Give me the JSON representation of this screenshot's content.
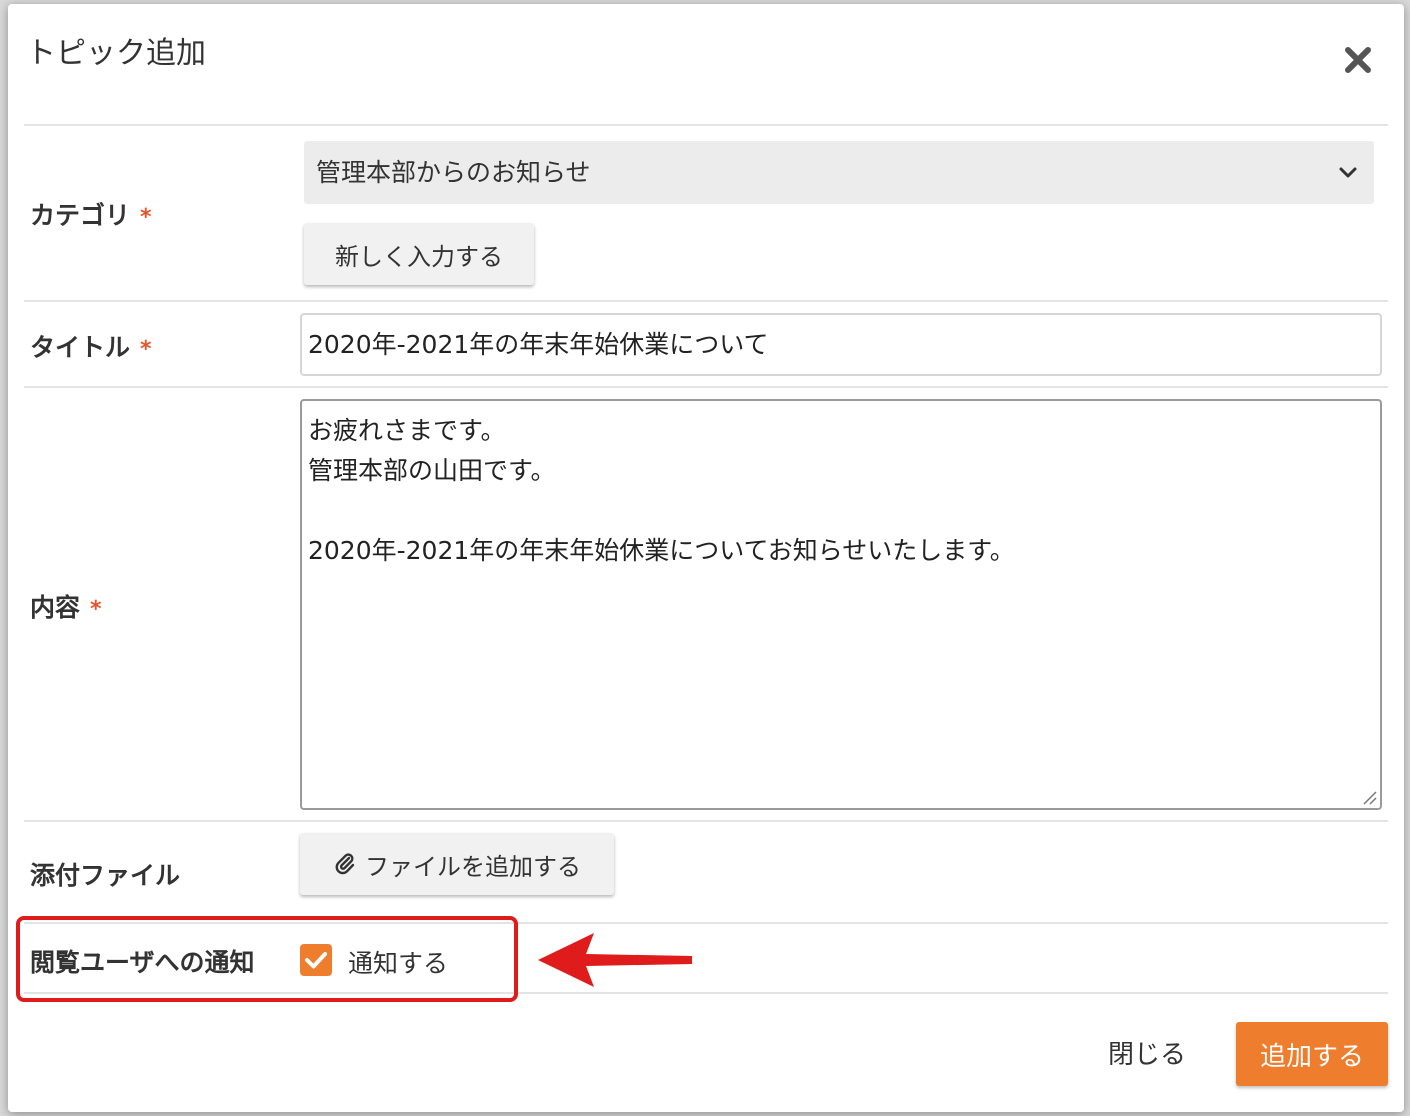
{
  "dialog": {
    "title": "トピック追加",
    "close_icon": "close-icon"
  },
  "fields": {
    "category": {
      "label": "カテゴリ",
      "required_mark": "*",
      "selected": "管理本部からのお知らせ",
      "new_button_label": "新しく入力する"
    },
    "title": {
      "label": "タイトル",
      "required_mark": "*",
      "value": "2020年-2021年の年末年始休業について"
    },
    "content": {
      "label": "内容",
      "required_mark": "*",
      "lines": [
        "お疲れさまです。",
        "管理本部の山田です。",
        "",
        "2020年-2021年の年末年始休業についてお知らせいたします。"
      ]
    },
    "attachment": {
      "label": "添付ファイル",
      "button_label": "ファイルを追加する",
      "button_icon": "paperclip-icon"
    },
    "notify": {
      "label": "閲覧ユーザへの通知",
      "checkbox_label": "通知する",
      "checked": true
    }
  },
  "footer": {
    "close_label": "閉じる",
    "submit_label": "追加する"
  },
  "colors": {
    "accent": "#ef7d2e",
    "required": "#e8542a",
    "annotation": "#e01b1b"
  }
}
